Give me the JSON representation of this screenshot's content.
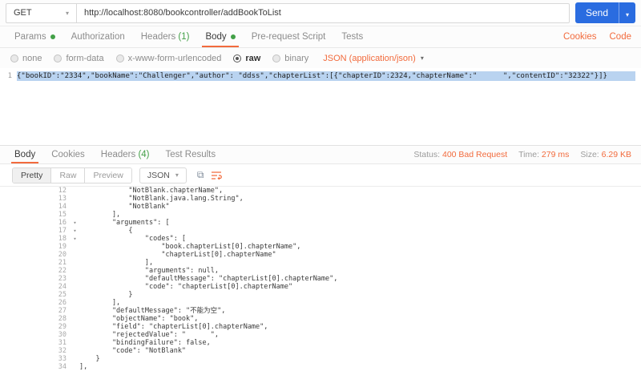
{
  "icons": {
    "caret_down": "▾",
    "fold_open": "▾",
    "copy": "⧉"
  },
  "request": {
    "method": "GET",
    "url": "http://localhost:8080/bookcontroller/addBookToList",
    "send_label": "Send",
    "tabs": [
      {
        "label": "Params",
        "dot": true,
        "active": false
      },
      {
        "label": "Authorization",
        "dot": false,
        "active": false
      },
      {
        "label": "Headers",
        "count": "(1)",
        "dot": false,
        "active": false
      },
      {
        "label": "Body",
        "dot": true,
        "active": true
      },
      {
        "label": "Pre-request Script",
        "dot": false,
        "active": false
      },
      {
        "label": "Tests",
        "dot": false,
        "active": false
      }
    ],
    "links": {
      "cookies": "Cookies",
      "code": "Code"
    },
    "body_modes": [
      {
        "label": "none",
        "selected": false
      },
      {
        "label": "form-data",
        "selected": false
      },
      {
        "label": "x-www-form-urlencoded",
        "selected": false
      },
      {
        "label": "raw",
        "selected": true
      },
      {
        "label": "binary",
        "selected": false
      }
    ],
    "content_type": "JSON (application/json)",
    "editor": {
      "line_number": "1",
      "content": "{\"bookID\":\"2334\",\"bookName\":\"Challenger\",\"author\": \"ddss\",\"chapterList\":[{\"chapterID\":2324,\"chapterName\":\"      \",\"contentID\":\"32322\"}]}"
    }
  },
  "response": {
    "tabs": [
      {
        "label": "Body",
        "active": true
      },
      {
        "label": "Cookies",
        "active": false
      },
      {
        "label": "Headers",
        "count": "(4)",
        "active": false
      },
      {
        "label": "Test Results",
        "active": false
      }
    ],
    "meta": [
      {
        "label": "Status:",
        "value": "400 Bad Request"
      },
      {
        "label": "Time:",
        "value": "279 ms"
      },
      {
        "label": "Size:",
        "value": "6.29 KB"
      }
    ],
    "view_modes": [
      {
        "label": "Pretty",
        "active": true
      },
      {
        "label": "Raw",
        "active": false
      },
      {
        "label": "Preview",
        "active": false
      }
    ],
    "format": "JSON",
    "lines": [
      {
        "n": "12",
        "fold": false,
        "text": "            \"NotBlank.chapterName\","
      },
      {
        "n": "13",
        "fold": false,
        "text": "            \"NotBlank.java.lang.String\","
      },
      {
        "n": "14",
        "fold": false,
        "text": "            \"NotBlank\""
      },
      {
        "n": "15",
        "fold": false,
        "text": "        ],"
      },
      {
        "n": "16",
        "fold": true,
        "text": "        \"arguments\": ["
      },
      {
        "n": "17",
        "fold": true,
        "text": "            {"
      },
      {
        "n": "18",
        "fold": true,
        "text": "                \"codes\": ["
      },
      {
        "n": "19",
        "fold": false,
        "text": "                    \"book.chapterList[0].chapterName\","
      },
      {
        "n": "20",
        "fold": false,
        "text": "                    \"chapterList[0].chapterName\""
      },
      {
        "n": "21",
        "fold": false,
        "text": "                ],"
      },
      {
        "n": "22",
        "fold": false,
        "text": "                \"arguments\": null,"
      },
      {
        "n": "23",
        "fold": false,
        "text": "                \"defaultMessage\": \"chapterList[0].chapterName\","
      },
      {
        "n": "24",
        "fold": false,
        "text": "                \"code\": \"chapterList[0].chapterName\""
      },
      {
        "n": "25",
        "fold": false,
        "text": "            }"
      },
      {
        "n": "26",
        "fold": false,
        "text": "        ],"
      },
      {
        "n": "27",
        "fold": false,
        "text": "        \"defaultMessage\": \"不能为空\","
      },
      {
        "n": "28",
        "fold": false,
        "text": "        \"objectName\": \"book\","
      },
      {
        "n": "29",
        "fold": false,
        "text": "        \"field\": \"chapterList[0].chapterName\","
      },
      {
        "n": "30",
        "fold": false,
        "text": "        \"rejectedValue\": \"      \","
      },
      {
        "n": "31",
        "fold": false,
        "text": "        \"bindingFailure\": false,"
      },
      {
        "n": "32",
        "fold": false,
        "text": "        \"code\": \"NotBlank\""
      },
      {
        "n": "33",
        "fold": false,
        "text": "    }"
      },
      {
        "n": "34",
        "fold": false,
        "text": "],"
      }
    ]
  }
}
